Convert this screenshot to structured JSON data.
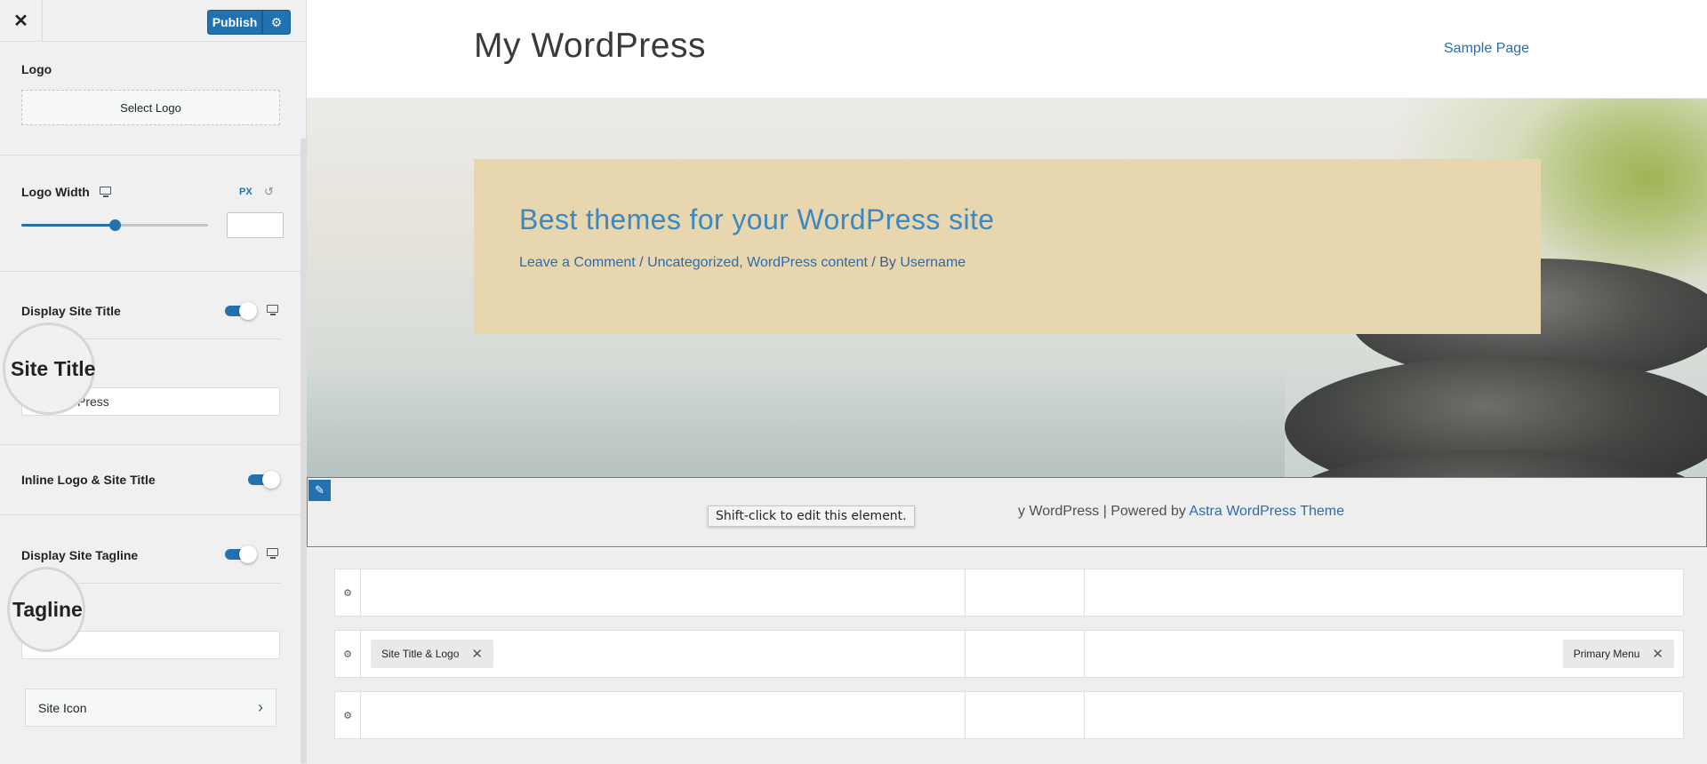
{
  "customizer": {
    "close_label": "✕",
    "publish_label": "Publish",
    "publish_settings_icon": "gear-icon",
    "logo": {
      "label": "Logo",
      "select_button": "Select Logo"
    },
    "logo_width": {
      "label": "Logo Width",
      "unit": "PX",
      "slider_value_fraction": 0.5,
      "device_icon": "desktop-icon",
      "reset_icon": "reset-icon"
    },
    "display_site_title": {
      "label": "Display Site Title",
      "enabled": true
    },
    "site_title": {
      "label": "Site Title",
      "visible_value": "Press"
    },
    "inline_logo_title": {
      "label": "Inline Logo & Site Title",
      "enabled": true
    },
    "display_site_tagline": {
      "label": "Display Site Tagline",
      "enabled": true
    },
    "tagline": {
      "label": "Tagline",
      "value": ""
    },
    "site_icon": {
      "label": "Site Icon"
    }
  },
  "preview": {
    "site_title": "My WordPress",
    "nav": [
      "Sample Page"
    ],
    "post": {
      "title": "Best themes for your WordPress site",
      "meta_comment": "Leave a Comment",
      "meta_sep": " / ",
      "meta_categories": "Uncategorized, WordPress content",
      "meta_by": " / By ",
      "meta_author": "Username"
    },
    "footer": {
      "text_visible": "y WordPress | Powered by ",
      "theme_link": "Astra WordPress Theme",
      "tooltip": "Shift-click to edit this element."
    },
    "builder": {
      "rows": [
        {
          "items": []
        },
        {
          "items": [
            {
              "label": "Site Title & Logo",
              "zone": "left"
            },
            {
              "label": "Primary Menu",
              "zone": "right"
            }
          ]
        },
        {
          "items": []
        }
      ]
    }
  },
  "colors": {
    "accent": "#2271b1",
    "link": "#2b6cb0",
    "post_box": "#e8d7ae"
  }
}
